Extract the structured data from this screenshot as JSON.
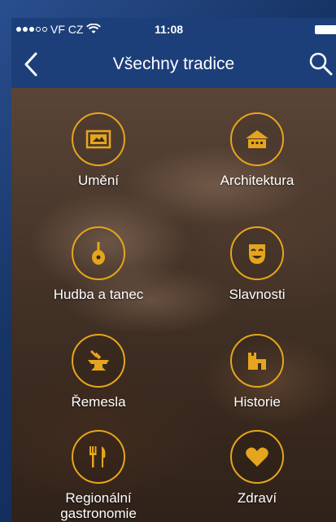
{
  "status_bar": {
    "carrier": "VF CZ",
    "time": "11:08"
  },
  "nav": {
    "title": "Všechny tradice"
  },
  "categories": [
    {
      "label": "Umění",
      "icon": "painting-icon"
    },
    {
      "label": "Architektura",
      "icon": "house-icon"
    },
    {
      "label": "Hudba a tanec",
      "icon": "lute-icon"
    },
    {
      "label": "Slavnosti",
      "icon": "mask-icon"
    },
    {
      "label": "Řemesla",
      "icon": "anvil-icon"
    },
    {
      "label": "Historie",
      "icon": "castle-icon"
    },
    {
      "label": "Regionální gastronomie",
      "icon": "fork-knife-icon"
    },
    {
      "label": "Zdraví",
      "icon": "heart-icon"
    }
  ],
  "colors": {
    "accent": "#e6a51c",
    "nav_bg": "#1c3f7a"
  }
}
